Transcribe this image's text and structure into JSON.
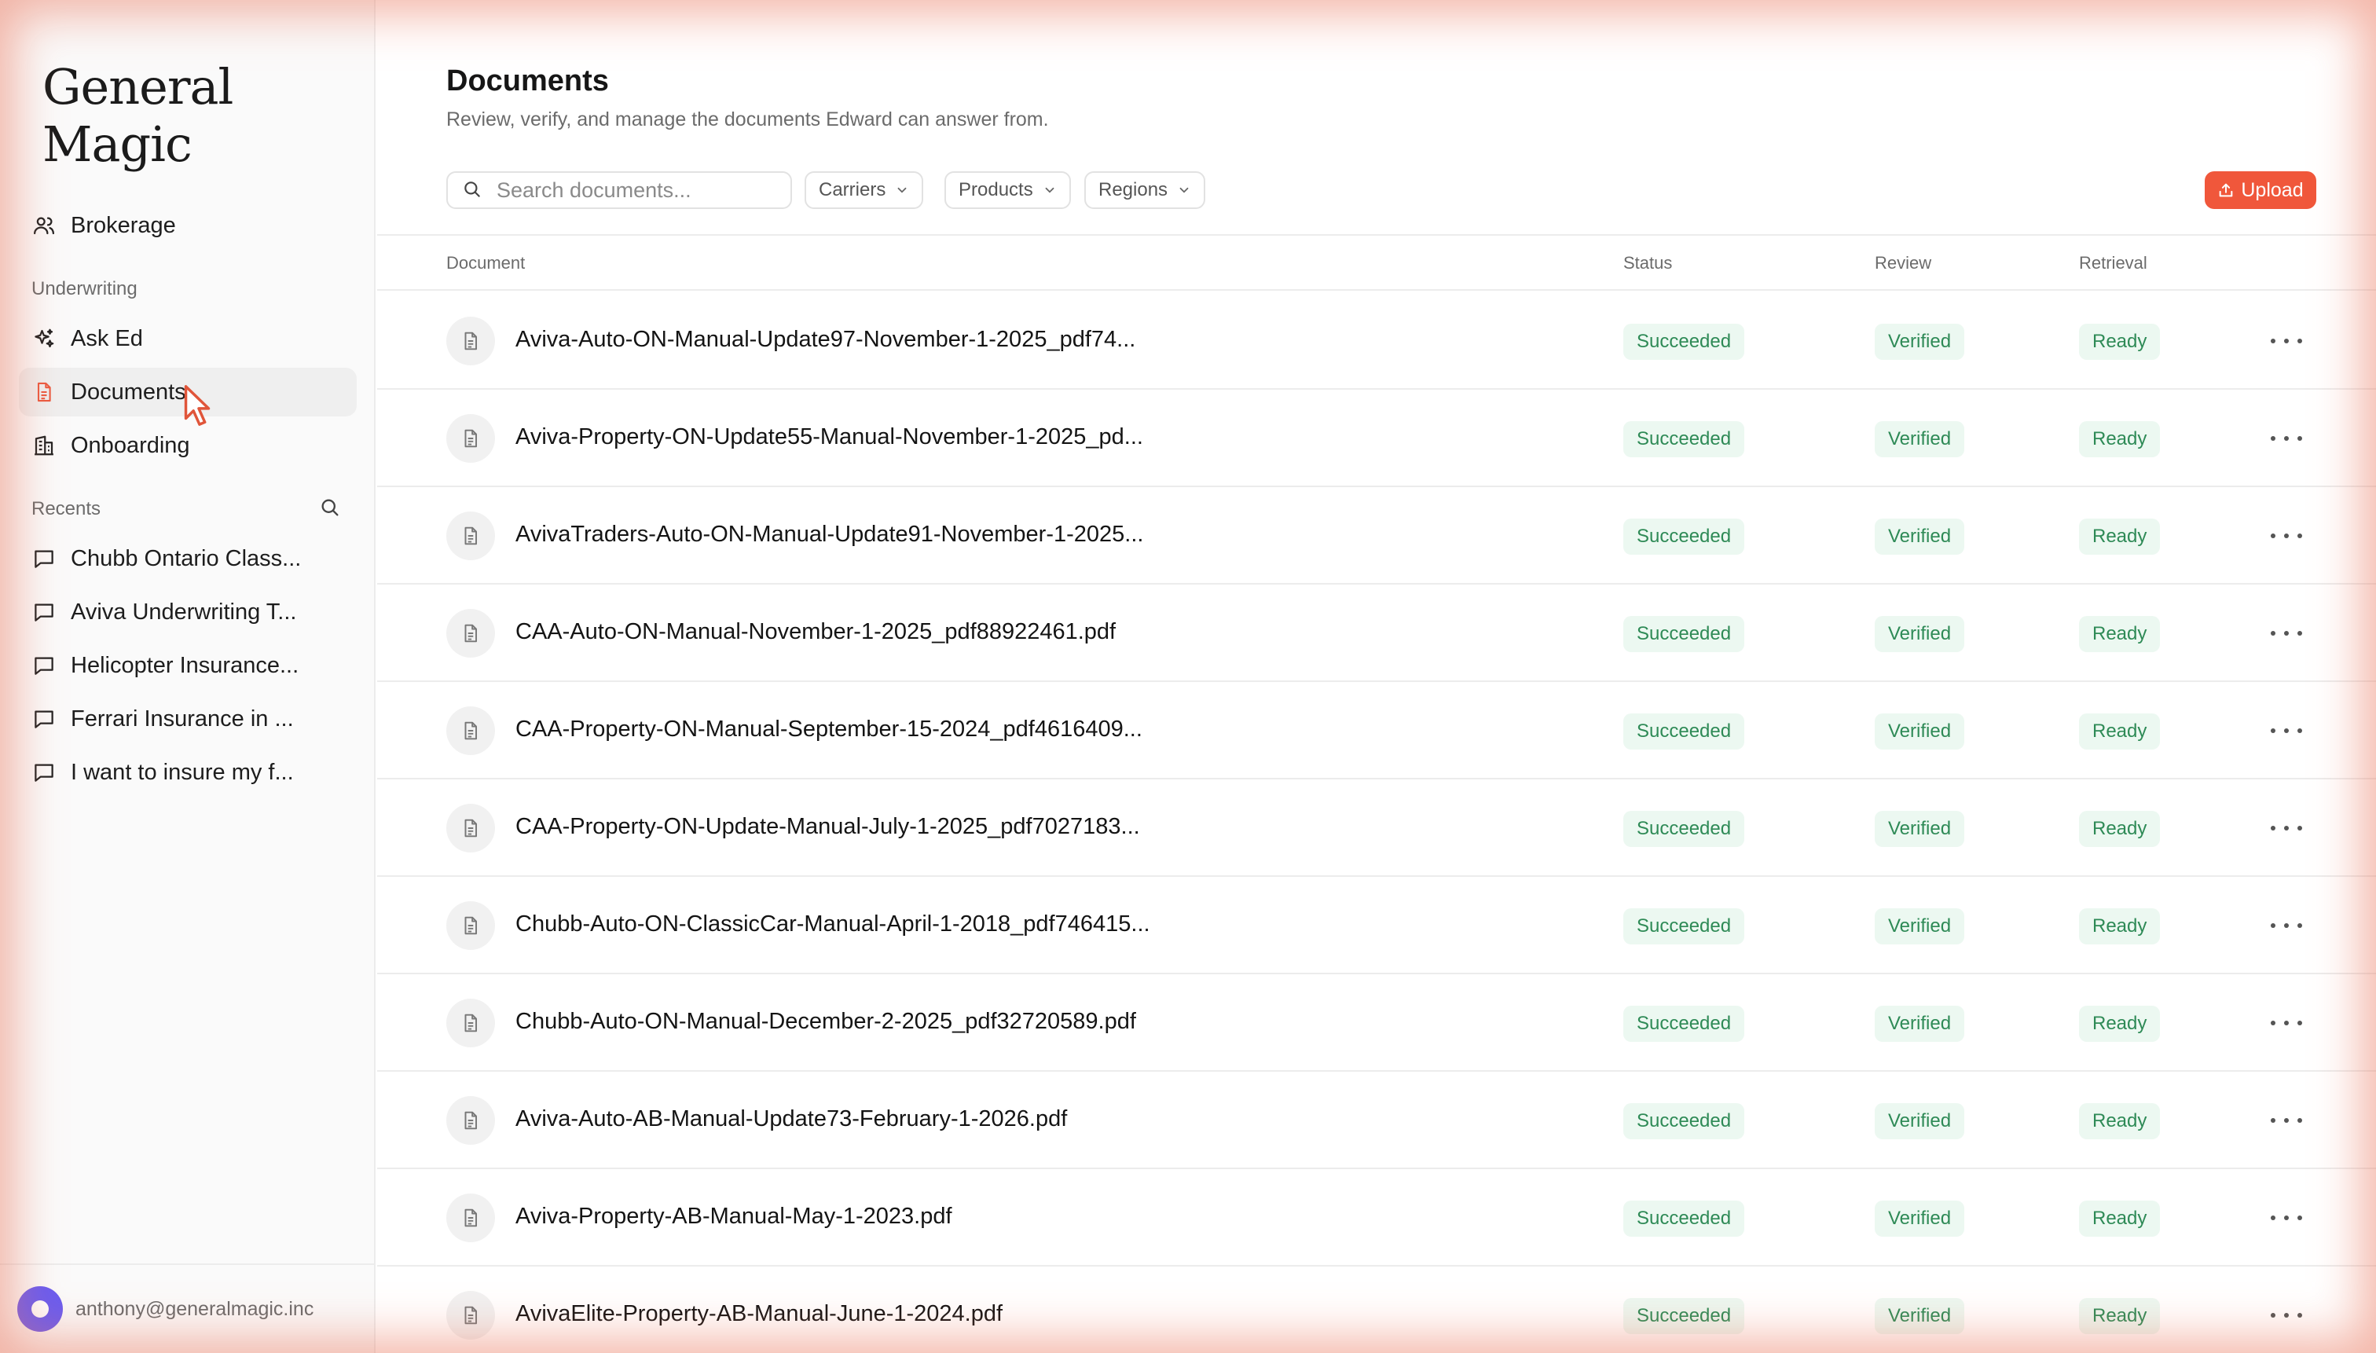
{
  "app": {
    "logo": "General Magic"
  },
  "sidebar": {
    "top_items": [
      {
        "label": "Brokerage",
        "icon": "users-icon"
      }
    ],
    "section_underwriting": "Underwriting",
    "items": [
      {
        "label": "Ask Ed",
        "icon": "sparkle-icon"
      },
      {
        "label": "Documents",
        "icon": "document-icon",
        "active": true
      },
      {
        "label": "Onboarding",
        "icon": "building-icon"
      }
    ],
    "section_recents": "Recents",
    "recents": [
      {
        "label": "Chubb Ontario Class..."
      },
      {
        "label": "Aviva Underwriting T..."
      },
      {
        "label": "Helicopter Insurance..."
      },
      {
        "label": "Ferrari Insurance in ..."
      },
      {
        "label": "I want to insure my f..."
      }
    ],
    "user_email": "anthony@generalmagic.inc"
  },
  "main": {
    "title": "Documents",
    "subtitle": "Review, verify, and manage the documents Edward can answer from.",
    "search_placeholder": "Search documents...",
    "filters": [
      "Carriers",
      "Products",
      "Regions"
    ],
    "upload_label": "Upload",
    "columns": {
      "document": "Document",
      "status": "Status",
      "review": "Review",
      "retrieval": "Retrieval"
    },
    "rows": [
      {
        "name": "Aviva-Auto-ON-Manual-Update97-November-1-2025_pdf74...",
        "status": "Succeeded",
        "review": "Verified",
        "retrieval": "Ready"
      },
      {
        "name": "Aviva-Property-ON-Update55-Manual-November-1-2025_pd...",
        "status": "Succeeded",
        "review": "Verified",
        "retrieval": "Ready"
      },
      {
        "name": "AvivaTraders-Auto-ON-Manual-Update91-November-1-2025...",
        "status": "Succeeded",
        "review": "Verified",
        "retrieval": "Ready"
      },
      {
        "name": "CAA-Auto-ON-Manual-November-1-2025_pdf88922461.pdf",
        "status": "Succeeded",
        "review": "Verified",
        "retrieval": "Ready"
      },
      {
        "name": "CAA-Property-ON-Manual-September-15-2024_pdf4616409...",
        "status": "Succeeded",
        "review": "Verified",
        "retrieval": "Ready"
      },
      {
        "name": "CAA-Property-ON-Update-Manual-July-1-2025_pdf7027183...",
        "status": "Succeeded",
        "review": "Verified",
        "retrieval": "Ready"
      },
      {
        "name": "Chubb-Auto-ON-ClassicCar-Manual-April-1-2018_pdf746415...",
        "status": "Succeeded",
        "review": "Verified",
        "retrieval": "Ready"
      },
      {
        "name": "Chubb-Auto-ON-Manual-December-2-2025_pdf32720589.pdf",
        "status": "Succeeded",
        "review": "Verified",
        "retrieval": "Ready"
      },
      {
        "name": "Aviva-Auto-AB-Manual-Update73-February-1-2026.pdf",
        "status": "Succeeded",
        "review": "Verified",
        "retrieval": "Ready"
      },
      {
        "name": "Aviva-Property-AB-Manual-May-1-2023.pdf",
        "status": "Succeeded",
        "review": "Verified",
        "retrieval": "Ready"
      },
      {
        "name": "AvivaElite-Property-AB-Manual-June-1-2024.pdf",
        "status": "Succeeded",
        "review": "Verified",
        "retrieval": "Ready"
      }
    ]
  },
  "colors": {
    "accent": "#f0573b",
    "badge_bg": "#ecf8f1",
    "badge_text": "#2e8a56",
    "avatar": "#6a5cf0"
  }
}
